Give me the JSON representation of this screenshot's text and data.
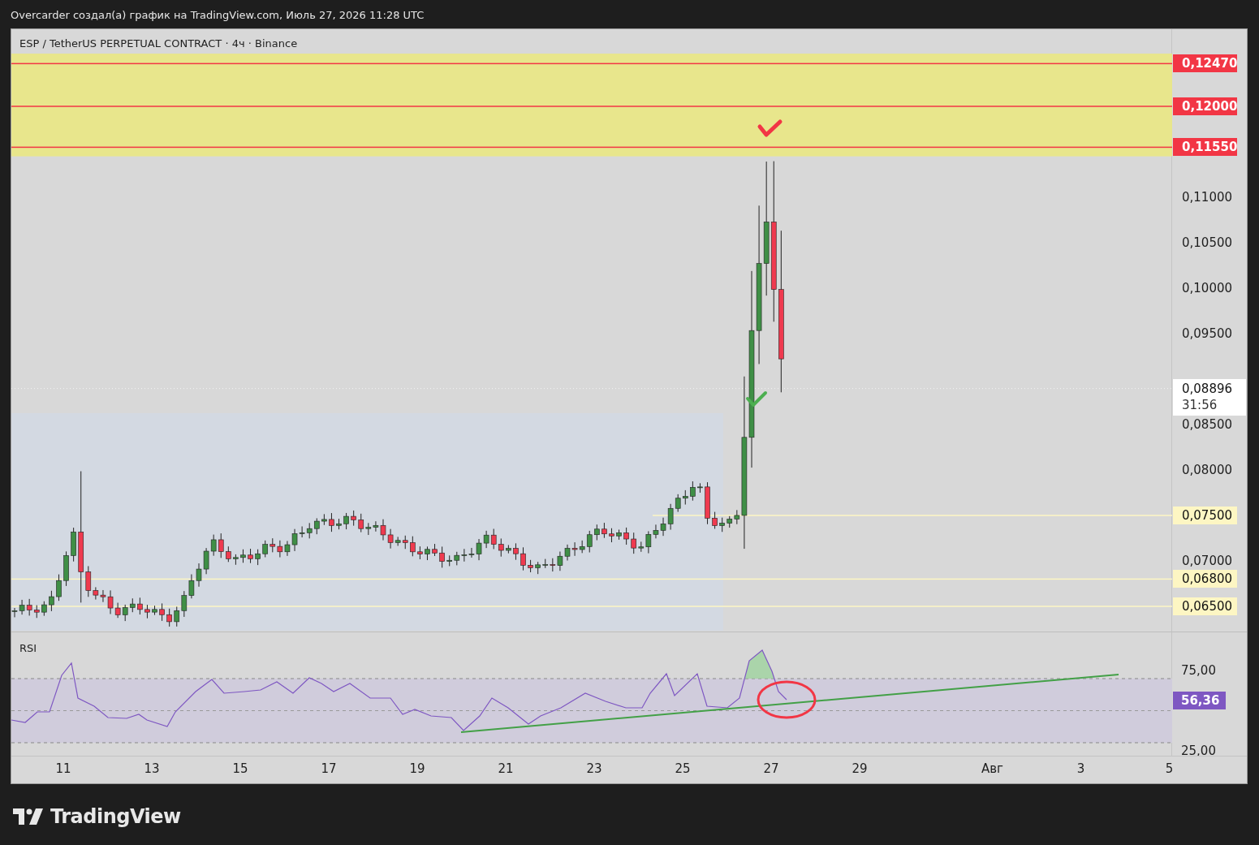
{
  "header": {
    "text": "Overcarder создал(а) график на TradingView.com, Июль 27, 2026 11:28 UTC"
  },
  "chart": {
    "title": "ESP / TetherUS PERPETUAL CONTRACT · 4ч · Binance",
    "price_labels": [
      {
        "text": "0,12470",
        "kind": "alert"
      },
      {
        "text": "0,12000",
        "kind": "alert"
      },
      {
        "text": "0,11550",
        "kind": "alert"
      },
      {
        "text": "0,11000",
        "kind": "tick"
      },
      {
        "text": "0,10500",
        "kind": "tick"
      },
      {
        "text": "0,10000",
        "kind": "tick"
      },
      {
        "text": "0,09500",
        "kind": "tick"
      },
      {
        "text": "0,08500",
        "kind": "tick"
      },
      {
        "text": "0,08000",
        "kind": "tick"
      },
      {
        "text": "0,07500",
        "kind": "level"
      },
      {
        "text": "0,07000",
        "kind": "tick"
      },
      {
        "text": "0,06800",
        "kind": "level"
      },
      {
        "text": "0,06500",
        "kind": "level"
      }
    ],
    "current_price": {
      "price": "0,08896",
      "countdown": "31:56"
    },
    "rsi": {
      "label": "RSI",
      "axis_labels": [
        {
          "text": "75,00",
          "kind": "tick"
        },
        {
          "text": "56,36",
          "kind": "current"
        },
        {
          "text": "25,00",
          "kind": "tick"
        }
      ]
    },
    "time_labels": [
      "11",
      "13",
      "15",
      "17",
      "19",
      "21",
      "23",
      "25",
      "27",
      "29",
      "Авг",
      "3",
      "5"
    ]
  },
  "brand": {
    "name": "TradingView"
  }
}
